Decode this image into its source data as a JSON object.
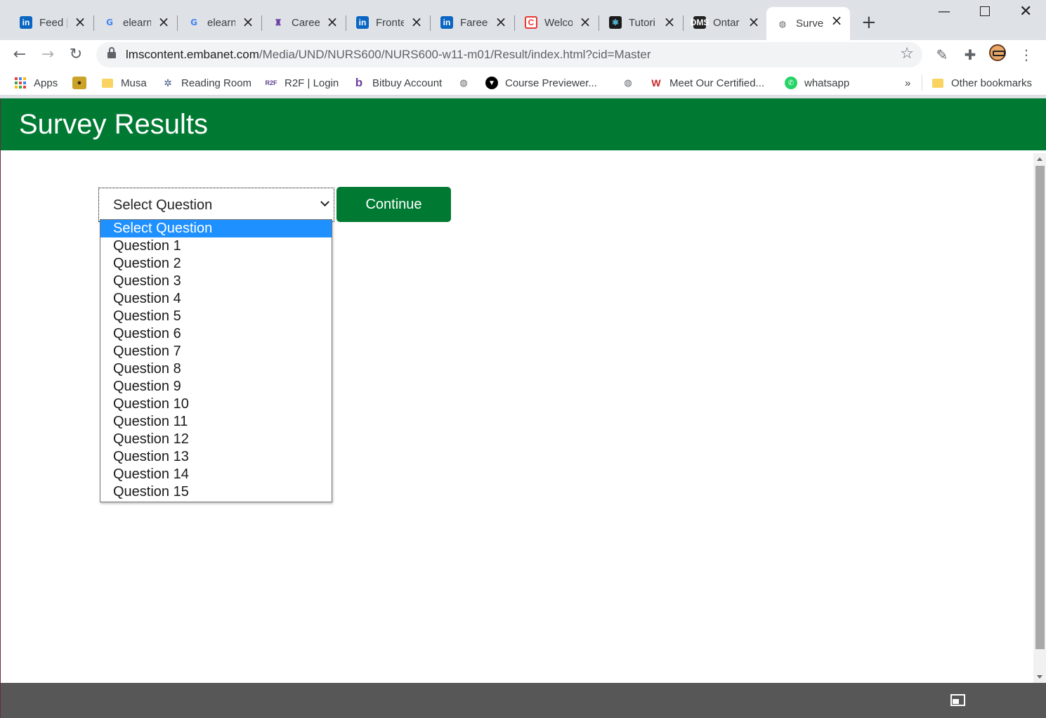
{
  "tabs": [
    {
      "title": "Feed |",
      "icon": "linkedin-icon"
    },
    {
      "title": "elearn",
      "icon": "google-icon"
    },
    {
      "title": "elearn",
      "icon": "google-icon"
    },
    {
      "title": "Careers",
      "icon": "western-crest-icon"
    },
    {
      "title": "Fronte",
      "icon": "linkedin-icon"
    },
    {
      "title": "Fareed",
      "icon": "linkedin-icon"
    },
    {
      "title": "Welco",
      "icon": "c-logo-icon"
    },
    {
      "title": "Tutori",
      "icon": "react-icon"
    },
    {
      "title": "Ontar",
      "icon": "dms-icon"
    },
    {
      "title": "Surve",
      "icon": "globe-icon",
      "active": true
    }
  ],
  "toolbar": {
    "url_host": "lmscontent.embanet.com",
    "url_path": "/Media/UND/NURS600/NURS600-w11-m01/Result/index.html?cid=Master"
  },
  "bookmarks": {
    "items": [
      "Apps",
      "Musa",
      "Reading Room",
      "R2F | Login",
      "Bitbuy Account",
      "Course Previewer...",
      "Meet Our Certified...",
      "whatsapp"
    ],
    "overflow": "»",
    "other": "Other bookmarks"
  },
  "page": {
    "title": "Survey Results",
    "select": {
      "value": "Select Question",
      "options": [
        "Select Question",
        "Question 1",
        "Question 2",
        "Question 3",
        "Question 4",
        "Question 5",
        "Question 6",
        "Question 7",
        "Question 8",
        "Question 9",
        "Question 10",
        "Question 11",
        "Question 12",
        "Question 13",
        "Question 14",
        "Question 15"
      ]
    },
    "continue_label": "Continue"
  },
  "colors": {
    "brand_green": "#007a33",
    "selected_option": "#1e90ff",
    "footer": "#575757"
  }
}
